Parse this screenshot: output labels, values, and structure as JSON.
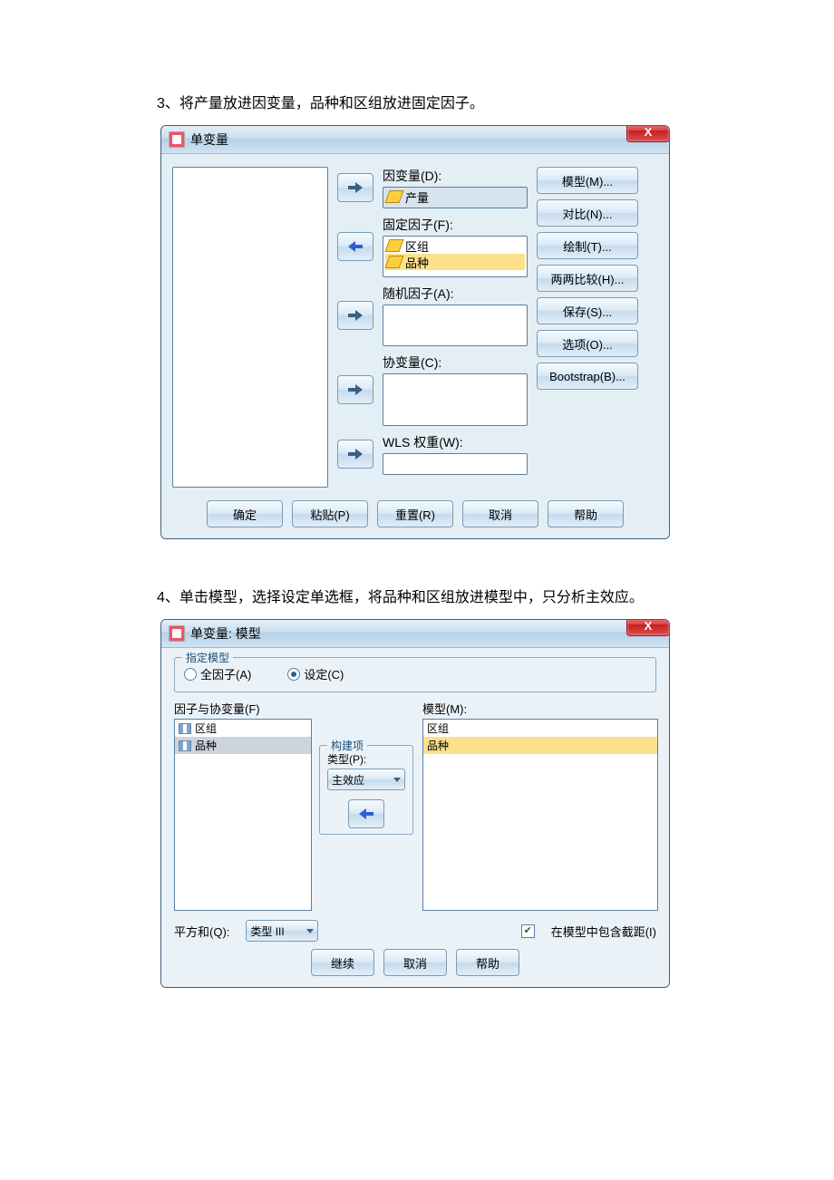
{
  "step3": "3、将产量放进因变量，品种和区组放进固定因子。",
  "d1": {
    "title": "单变量",
    "dv_label": "因变量(D):",
    "dv_item": "产量",
    "ff_label": "固定因子(F):",
    "ff_item1": "区组",
    "ff_item2": "品种",
    "rf_label": "随机因子(A):",
    "cov_label": "协变量(C):",
    "wls_label": "WLS 权重(W):",
    "side": {
      "model": "模型(M)...",
      "contrast": "对比(N)...",
      "plot": "绘制(T)...",
      "posthoc": "两两比较(H)...",
      "save": "保存(S)...",
      "options": "选项(O)...",
      "boot": "Bootstrap(B)..."
    },
    "foot": {
      "ok": "确定",
      "paste": "粘贴(P)",
      "reset": "重置(R)",
      "cancel": "取消",
      "help": "帮助"
    }
  },
  "step4": "4、单击模型，选择设定单选框，将品种和区组放进模型中，只分析主效应。",
  "d2": {
    "title": "单变量: 模型",
    "spec_legend": "指定模型",
    "rb_full": "全因子(A)",
    "rb_custom": "设定(C)",
    "fac_label": "因子与协变量(F)",
    "fac1": "区组",
    "fac2": "品种",
    "build_legend": "构建项",
    "type_label": "类型(P):",
    "type_value": "主效应",
    "model_label": "模型(M):",
    "m1": "区组",
    "m2": "品种",
    "ss_label": "平方和(Q):",
    "ss_value": "类型 III",
    "intercept": "在模型中包含截距(I)",
    "foot": {
      "cont": "继续",
      "cancel": "取消",
      "help": "帮助"
    }
  }
}
